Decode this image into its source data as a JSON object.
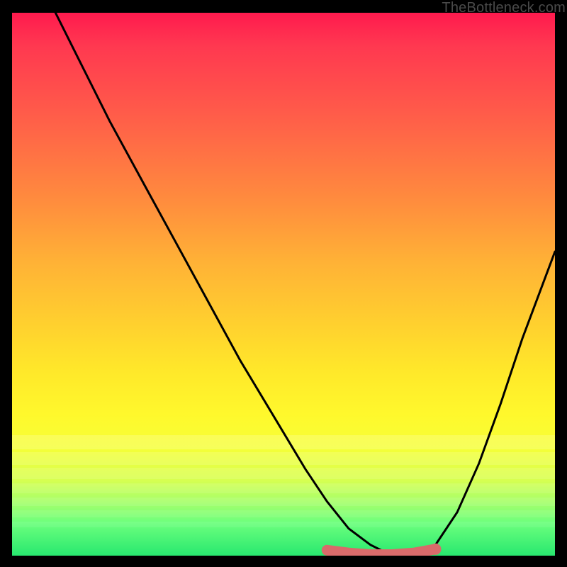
{
  "watermark": "TheBottleneck.com",
  "chart_data": {
    "type": "line",
    "title": "",
    "xlabel": "",
    "ylabel": "",
    "xlim": [
      0,
      100
    ],
    "ylim": [
      0,
      100
    ],
    "series": [
      {
        "name": "curve",
        "color": "#000000",
        "x": [
          8,
          12,
          18,
          24,
          30,
          36,
          42,
          48,
          54,
          58,
          62,
          66,
          70,
          74,
          78,
          82,
          86,
          90,
          94,
          100
        ],
        "values": [
          100,
          92,
          80,
          69,
          58,
          47,
          36,
          26,
          16,
          10,
          5,
          2,
          0,
          0,
          2,
          8,
          17,
          28,
          40,
          56
        ]
      }
    ],
    "highlight": {
      "name": "bottleneck-band",
      "color": "#d96a6a",
      "x": [
        58,
        62,
        66,
        70,
        74,
        78
      ],
      "values": [
        1,
        0.5,
        0.2,
        0.2,
        0.5,
        1.2
      ]
    },
    "gradient_stops": [
      {
        "pos": 0.0,
        "color": "#ff1a4e"
      },
      {
        "pos": 0.34,
        "color": "#ff8a3e"
      },
      {
        "pos": 0.66,
        "color": "#ffe82a"
      },
      {
        "pos": 0.86,
        "color": "#d8ff50"
      },
      {
        "pos": 1.0,
        "color": "#28e86f"
      }
    ]
  }
}
